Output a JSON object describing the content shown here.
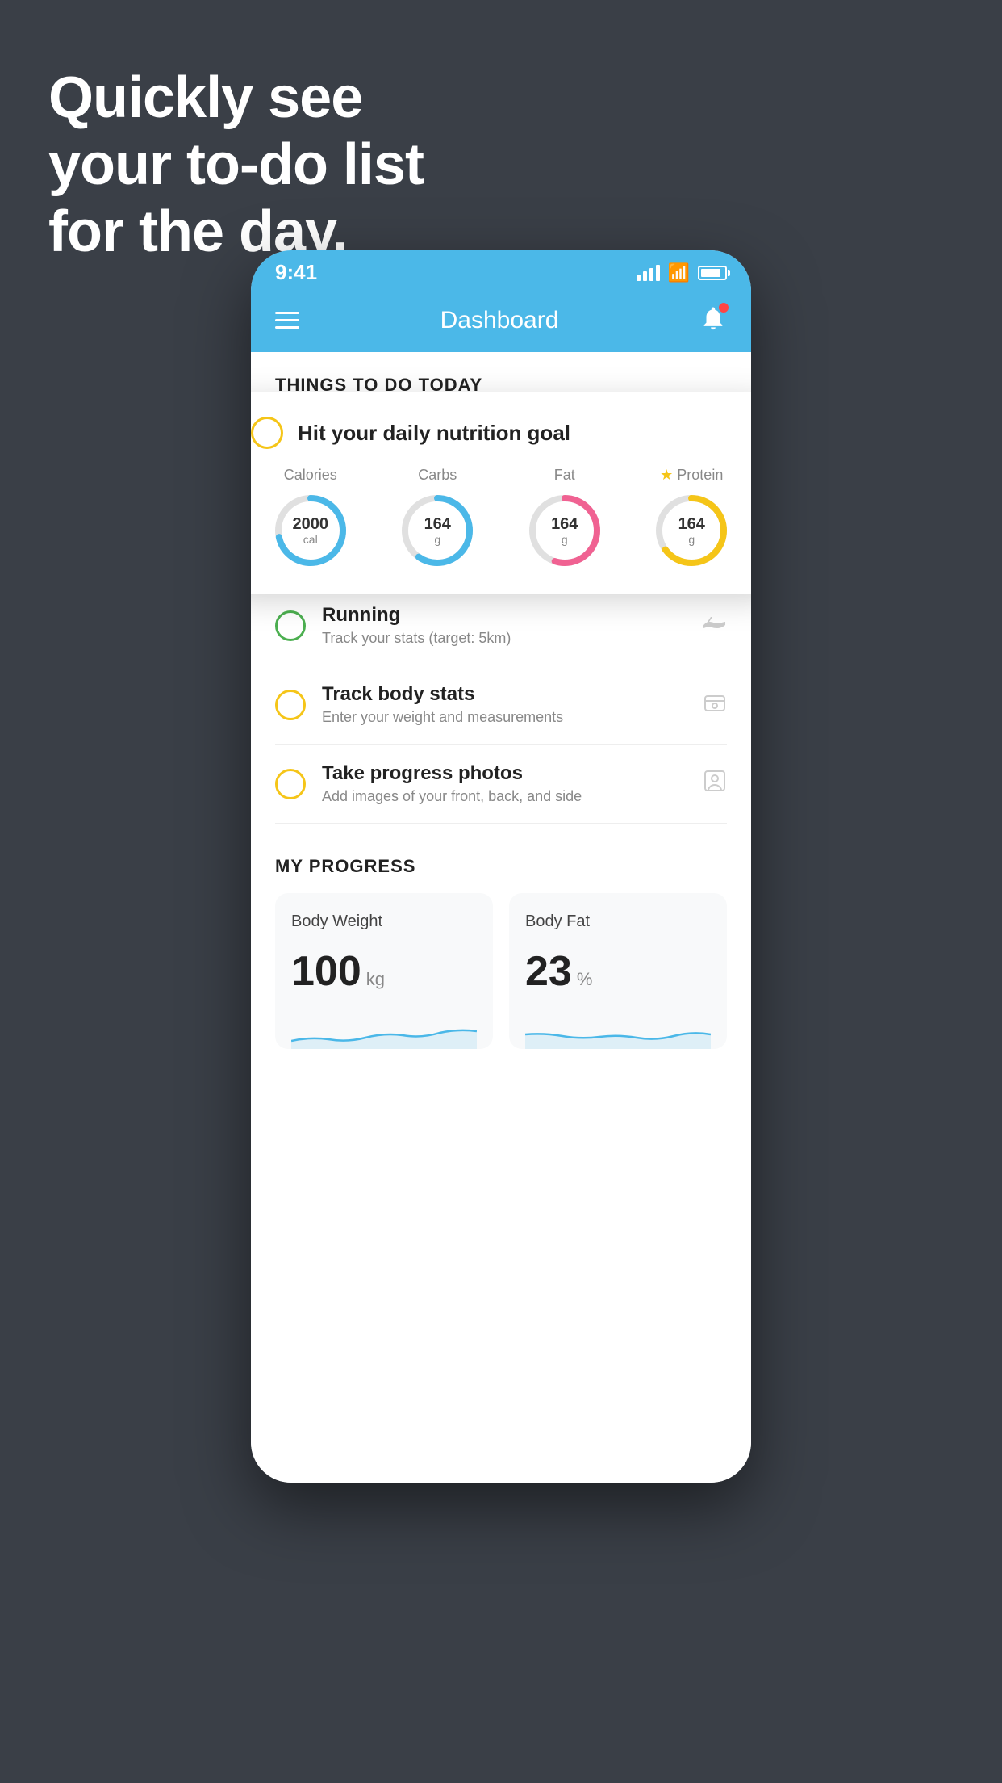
{
  "background_color": "#3a3f47",
  "hero": {
    "line1": "Quickly see",
    "line2": "your to-do list",
    "line3": "for the day."
  },
  "status_bar": {
    "time": "9:41"
  },
  "nav": {
    "title": "Dashboard"
  },
  "things_section": {
    "header": "THINGS TO DO TODAY"
  },
  "floating_card": {
    "circle_color": "#f5c518",
    "title": "Hit your daily nutrition goal",
    "nutrients": [
      {
        "label": "Calories",
        "value": "2000",
        "unit": "cal",
        "color": "#4bb8e8",
        "percent": 72
      },
      {
        "label": "Carbs",
        "value": "164",
        "unit": "g",
        "color": "#4bb8e8",
        "percent": 60
      },
      {
        "label": "Fat",
        "value": "164",
        "unit": "g",
        "color": "#f06292",
        "percent": 55
      },
      {
        "label": "Protein",
        "value": "164",
        "unit": "g",
        "color": "#f5c518",
        "percent": 65,
        "starred": true
      }
    ]
  },
  "todo_items": [
    {
      "circle_color": "green",
      "title": "Running",
      "subtitle": "Track your stats (target: 5km)",
      "icon": "shoe"
    },
    {
      "circle_color": "yellow",
      "title": "Track body stats",
      "subtitle": "Enter your weight and measurements",
      "icon": "scale"
    },
    {
      "circle_color": "yellow",
      "title": "Take progress photos",
      "subtitle": "Add images of your front, back, and side",
      "icon": "person"
    }
  ],
  "progress_section": {
    "header": "MY PROGRESS",
    "cards": [
      {
        "title": "Body Weight",
        "value": "100",
        "unit": "kg"
      },
      {
        "title": "Body Fat",
        "value": "23",
        "unit": "%"
      }
    ]
  }
}
